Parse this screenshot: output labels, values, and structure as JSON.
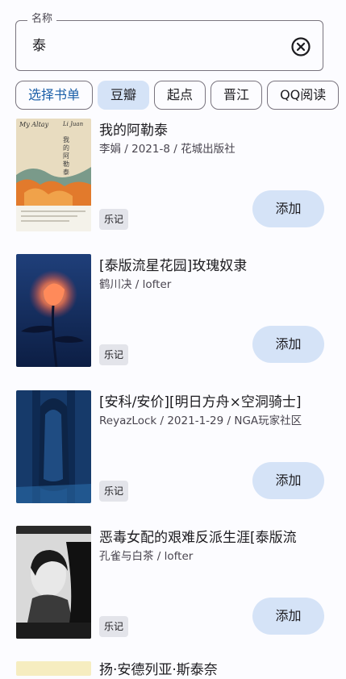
{
  "search": {
    "label": "名称",
    "value": "泰"
  },
  "chips": [
    "选择书单",
    "豆瓣",
    "起点",
    "晋江",
    "QQ阅读"
  ],
  "add_label": "添加",
  "books": [
    {
      "title": "我的阿勒泰",
      "meta": "李娟 / 2021-8 / 花城出版社",
      "tag": "乐记",
      "cover_text": {
        "top": "My Altay",
        "author": "Li Juan",
        "cn": "我的阿勒泰"
      }
    },
    {
      "title": "[泰版流星花园]玫瑰奴隶",
      "meta": "鹤川决 / lofter",
      "tag": "乐记"
    },
    {
      "title": "[安科/安价][明日方舟×空洞骑士]",
      "meta": "ReyazLock / 2021-1-29 / NGA玩家社区",
      "tag": "乐记"
    },
    {
      "title": "恶毒女配的艰难反派生涯[泰版流",
      "meta": "孔雀与白茶 / lofter",
      "tag": "乐记"
    }
  ],
  "partial_title": "扬·安德列亚·斯泰奈"
}
